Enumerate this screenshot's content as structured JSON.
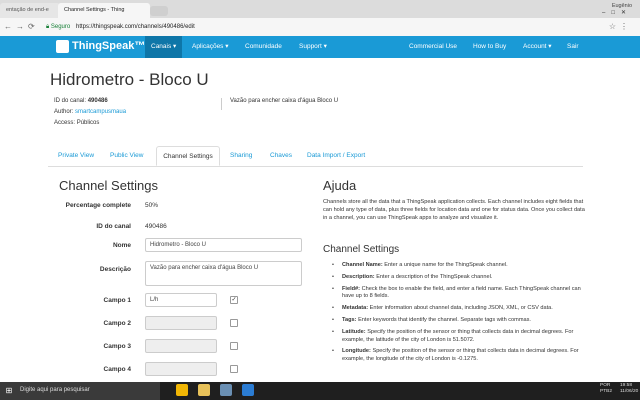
{
  "browser": {
    "tabs": [
      {
        "label": "entação de end-e"
      },
      {
        "label": "Channel Settings - Thing"
      }
    ],
    "window_user": "Eugênio",
    "secure_label": "Seguro",
    "url": "https://thingspeak.com/channels/490486/edit"
  },
  "nav": {
    "logo": "ThingSpeak™",
    "left": [
      "Canais ▾",
      "Aplicações ▾",
      "Comunidade",
      "Support ▾"
    ],
    "right": [
      "Commercial Use",
      "How to Buy",
      "Account ▾",
      "Sair"
    ],
    "active_color": "#0e76a8",
    "bar_color": "#1a9ad6"
  },
  "channel": {
    "title": "Hidrometro - Bloco U",
    "id_label": "ID do canal:",
    "id_value": "490486",
    "author_label": "Author:",
    "author_value": "smartcampusmaua",
    "access_label": "Access:",
    "access_value": "Públicos",
    "description": "Vazão para encher caixa d'água Bloco U"
  },
  "page_tabs": [
    "Private View",
    "Public View",
    "Channel Settings",
    "Sharing",
    "Chaves",
    "Data Import / Export"
  ],
  "settings": {
    "heading": "Channel Settings",
    "percentage_label": "Percentage complete",
    "percentage_value": "50%",
    "id_label": "ID do canal",
    "id_value": "490486",
    "name_label": "Nome",
    "name_value": "Hidrometro - Bloco U",
    "desc_label": "Descrição",
    "desc_value": "Vazão para encher caixa d'água Bloco U",
    "fields": [
      {
        "label": "Campo 1",
        "value": "L/h",
        "checked": true
      },
      {
        "label": "Campo 2",
        "value": "",
        "checked": false
      },
      {
        "label": "Campo 3",
        "value": "",
        "checked": false
      },
      {
        "label": "Campo 4",
        "value": "",
        "checked": false
      }
    ]
  },
  "help": {
    "heading": "Ajuda",
    "paragraph": "Channels store all the data that a ThingSpeak application collects. Each channel includes eight fields that can hold any type of data, plus three fields for location data and one for status data. Once you collect data in a channel, you can use ThingSpeak apps to analyze and visualize it.",
    "subheading": "Channel Settings",
    "items": [
      {
        "term": "Channel Name:",
        "text": "Enter a unique name for the ThingSpeak channel."
      },
      {
        "term": "Description:",
        "text": "Enter a description of the ThingSpeak channel."
      },
      {
        "term": "Field#:",
        "text": "Check the box to enable the field, and enter a field name. Each ThingSpeak channel can have up to 8 fields."
      },
      {
        "term": "Metadata:",
        "text": "Enter information about channel data, including JSON, XML, or CSV data."
      },
      {
        "term": "Tags:",
        "text": "Enter keywords that identify the channel. Separate tags with commas."
      },
      {
        "term": "Latitude:",
        "text": "Specify the position of the sensor or thing that collects data in decimal degrees. For example, the latitude of the city of London is 51.5072."
      },
      {
        "term": "Longitude:",
        "text": "Specify the position of the sensor or thing that collects data in decimal degrees. For example, the longitude of the city of London is -0.1275."
      }
    ]
  },
  "taskbar": {
    "search_placeholder": "Digite aqui para pesquisar",
    "lang": "POR",
    "lang2": "PTB2",
    "time": "19:58",
    "date": "11/06/20"
  }
}
